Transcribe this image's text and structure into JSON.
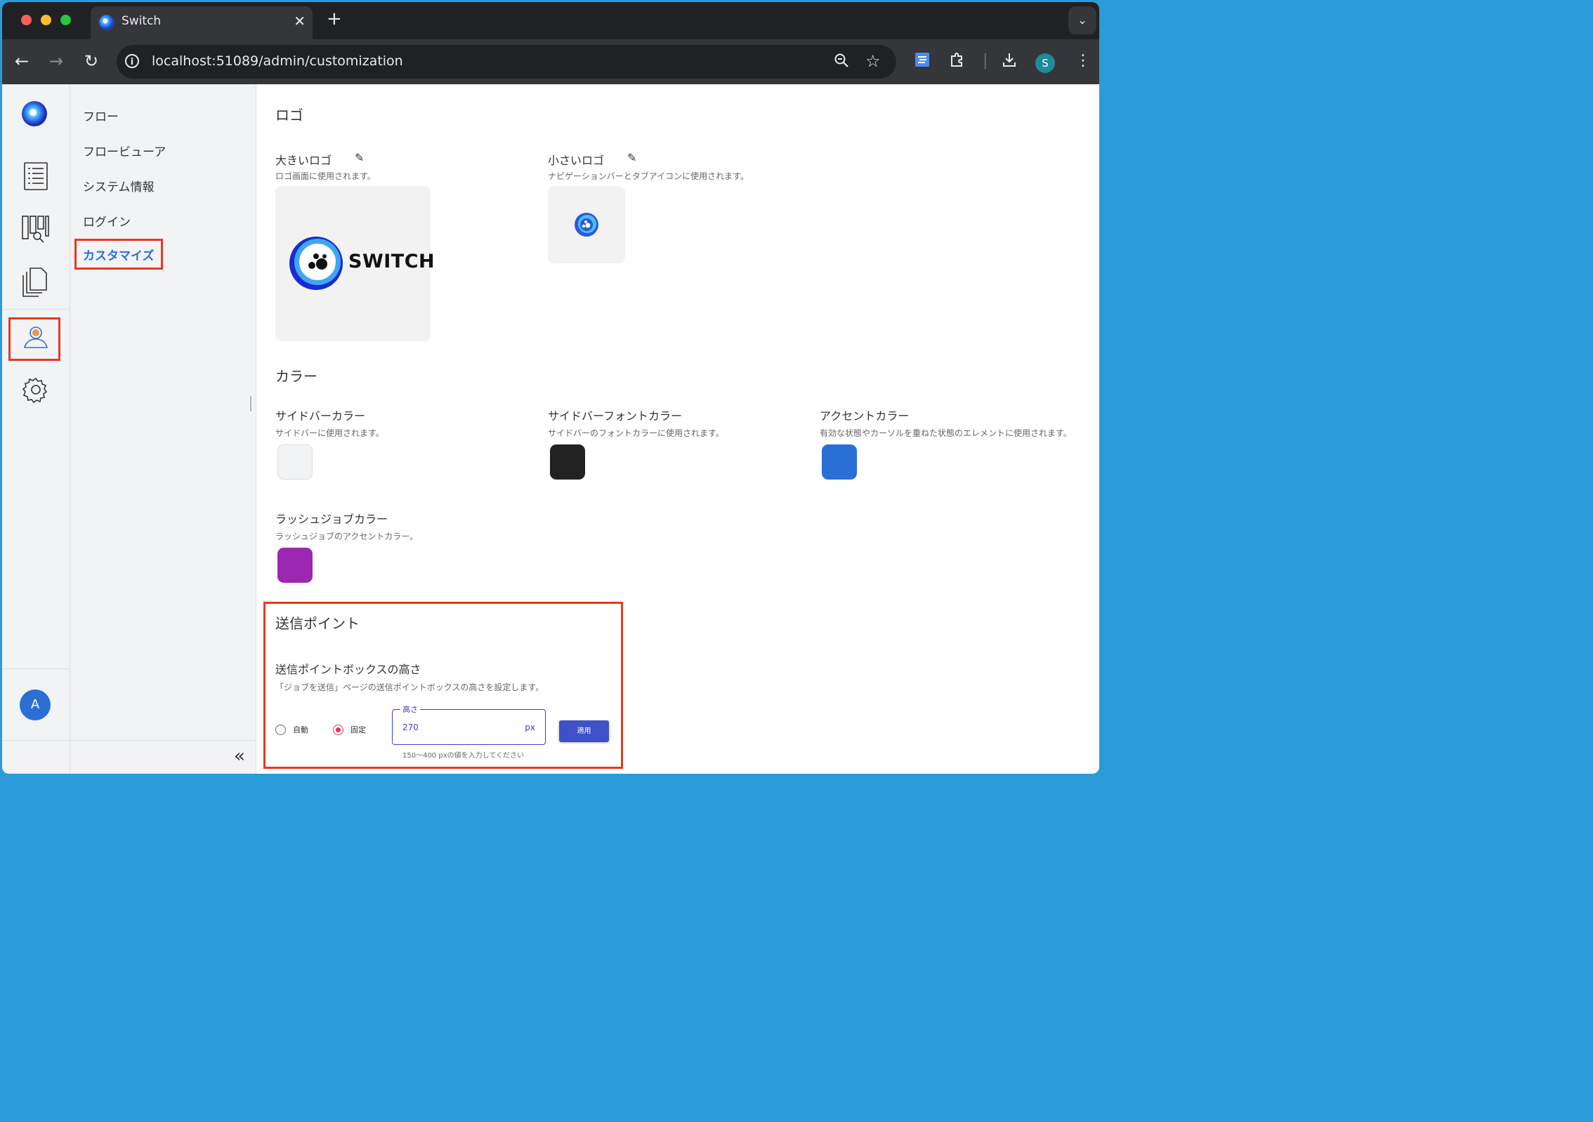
{
  "browser": {
    "tab_title": "Switch",
    "url": "localhost:51089/admin/customization",
    "profile_initial": "S"
  },
  "subnav": {
    "items": [
      {
        "label": "フロー"
      },
      {
        "label": "フロービューア"
      },
      {
        "label": "システム情報"
      },
      {
        "label": "ログイン"
      },
      {
        "label": "カスタマイズ",
        "active": true
      }
    ]
  },
  "user": {
    "avatar_initial": "A"
  },
  "logo_section": {
    "title": "ロゴ",
    "large": {
      "label": "大きいロゴ",
      "desc": "ロゴ画面に使用されます。",
      "brand_text": "SWITCH"
    },
    "small": {
      "label": "小さいロゴ",
      "desc": "ナビゲーションバーとタブアイコンに使用されます。"
    }
  },
  "color_section": {
    "title": "カラー",
    "items": [
      {
        "label": "サイドバーカラー",
        "desc": "サイドバーに使用されます。",
        "color": "#f2f3f5"
      },
      {
        "label": "サイドバーフォントカラー",
        "desc": "サイドバーのフォントカラーに使用されます。",
        "color": "#222222"
      },
      {
        "label": "アクセントカラー",
        "desc": "有効な状態やカーソルを重ねた状態のエレメントに使用されます。",
        "color": "#2a6fd6"
      },
      {
        "label": "ラッシュジョブカラー",
        "desc": "ラッシュジョブのアクセントカラー。",
        "color": "#9c27b0"
      }
    ]
  },
  "send_point": {
    "title": "送信ポイント",
    "box_height_label": "送信ポイントボックスの高さ",
    "box_height_desc": "「ジョブを送信」ページの送信ポイントボックスの高さを設定します。",
    "radio_auto": "自動",
    "radio_fixed": "固定",
    "selected": "固定",
    "field_label": "高さ",
    "field_value": "270",
    "field_unit": "px",
    "apply_label": "適用",
    "hint": "150〜400 pxの値を入力してください"
  }
}
